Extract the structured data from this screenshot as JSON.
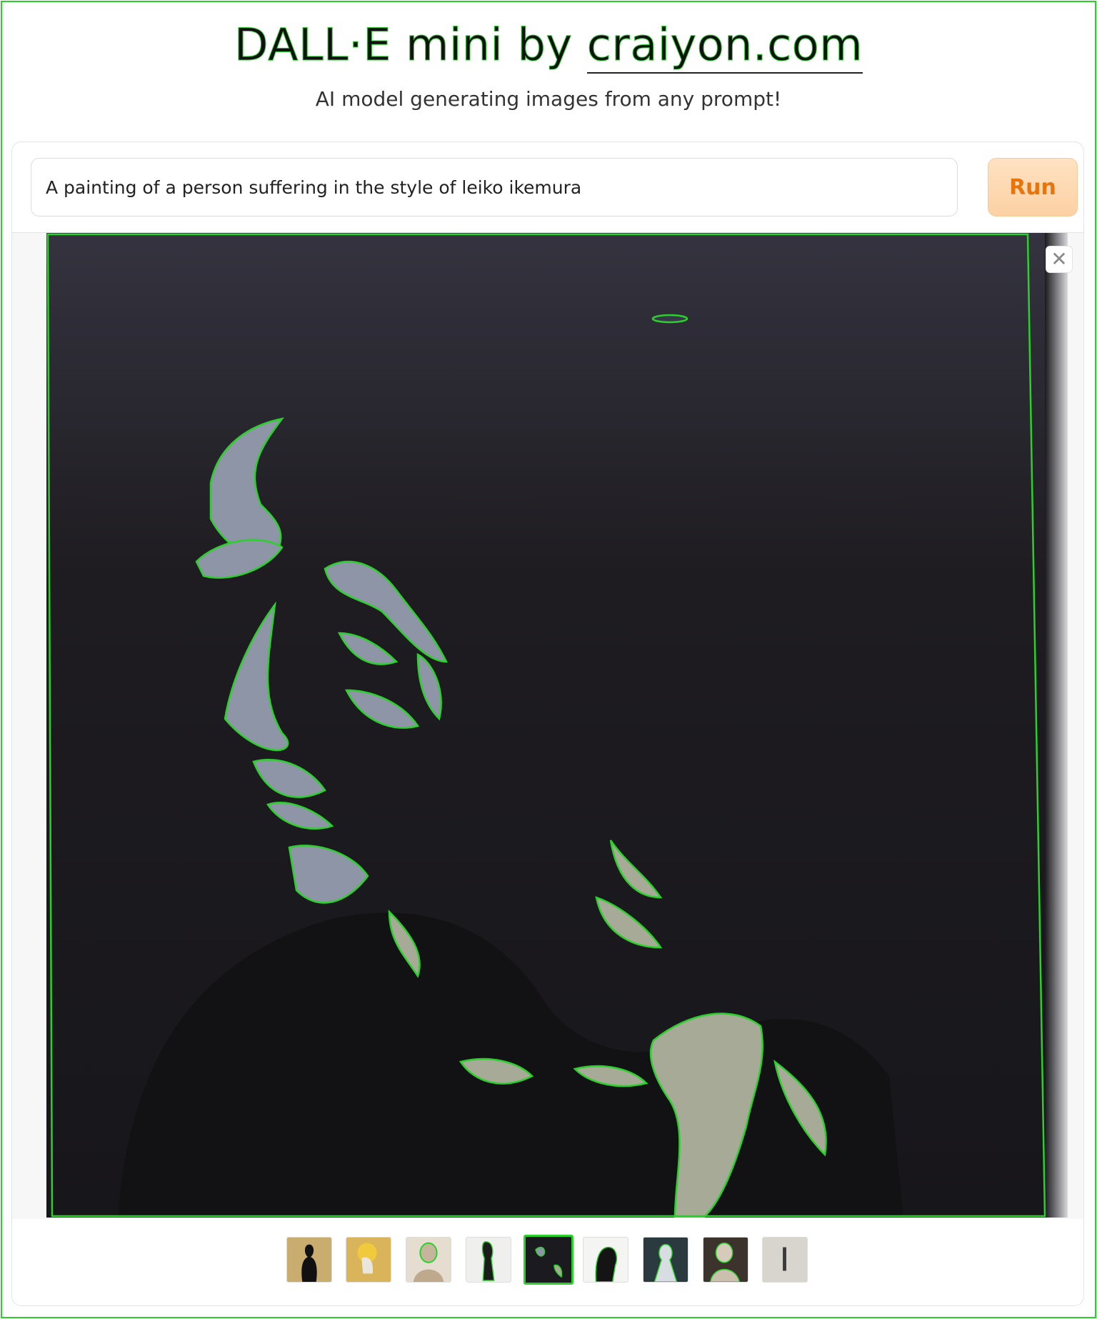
{
  "header": {
    "title_prefix": "DALL·E mini by ",
    "brand_link": "craiyon.com",
    "subtitle": "AI model generating images from any prompt!"
  },
  "prompt": {
    "value": "A painting of a person suffering in the style of leiko ikemura",
    "run_label": "Run"
  },
  "viewer": {
    "close_symbol": "✕"
  },
  "thumbnails": [
    {
      "name": "thumb-1",
      "selected": false
    },
    {
      "name": "thumb-2",
      "selected": false
    },
    {
      "name": "thumb-3",
      "selected": false
    },
    {
      "name": "thumb-4",
      "selected": false
    },
    {
      "name": "thumb-5",
      "selected": true
    },
    {
      "name": "thumb-6",
      "selected": false
    },
    {
      "name": "thumb-7",
      "selected": false
    },
    {
      "name": "thumb-8",
      "selected": false
    },
    {
      "name": "thumb-9",
      "selected": false
    }
  ],
  "colors": {
    "accent_outline": "#2bd12b",
    "run_text": "#e8740e",
    "run_bg": "#fcd1a4"
  }
}
